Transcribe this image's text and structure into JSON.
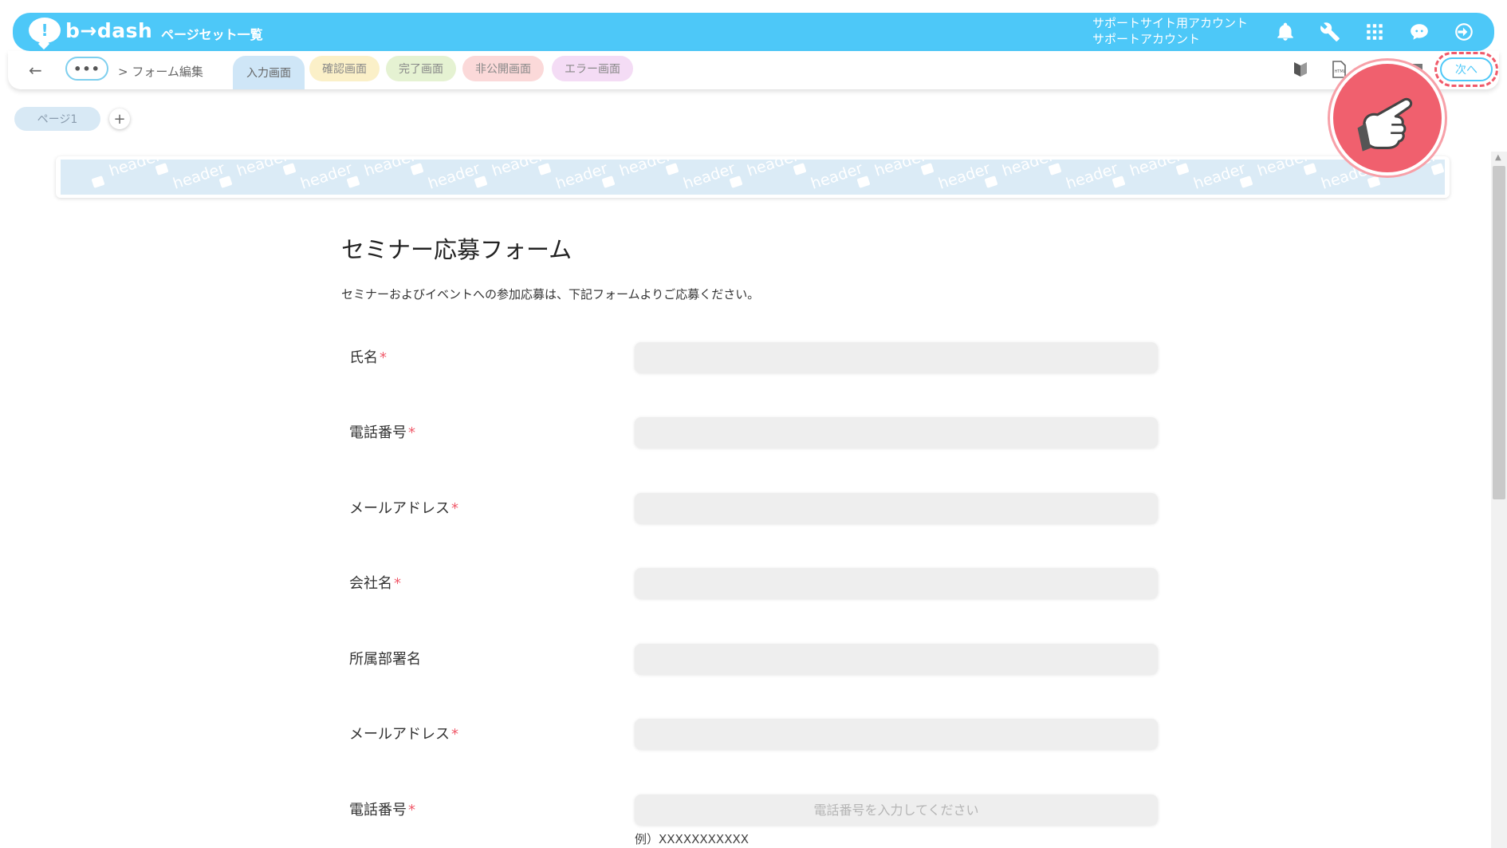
{
  "app": {
    "logo_text": "b→dash",
    "page_title": "ページセット一覧",
    "account_line1": "サポートサイト用アカウント",
    "account_line2": "サポートアカウント"
  },
  "nav": {
    "dots": "•••",
    "breadcrumb": "> フォーム編集",
    "tabs": [
      {
        "label": "入力画面",
        "bg": "#cfe6f7"
      },
      {
        "label": "確認画面",
        "bg": "#fbf0c8"
      },
      {
        "label": "完了画面",
        "bg": "#e5f2d2"
      },
      {
        "label": "非公開画面",
        "bg": "#fbd9d9"
      },
      {
        "label": "エラー画面",
        "bg": "#f4dcf5"
      }
    ],
    "next_label": "次へ"
  },
  "pages": {
    "tab_label": "ページ1",
    "add_label": "+"
  },
  "banner": {
    "word": "header"
  },
  "form": {
    "title": "セミナー応募フォーム",
    "description": "セミナーおよびイベントへの参加応募は、下記フォームよりご応募ください。",
    "required_mark": "*",
    "fields": [
      {
        "label": "氏名",
        "required": true,
        "placeholder": ""
      },
      {
        "label": "電話番号",
        "required": true,
        "placeholder": ""
      },
      {
        "label": "メールアドレス",
        "required": true,
        "placeholder": ""
      },
      {
        "label": "会社名",
        "required": true,
        "placeholder": ""
      },
      {
        "label": "所属部署名",
        "required": false,
        "placeholder": ""
      },
      {
        "label": "メールアドレス",
        "required": true,
        "placeholder": ""
      },
      {
        "label": "電話番号",
        "required": true,
        "placeholder": "電話番号を入力してください"
      }
    ],
    "phone_hint": "例）XXXXXXXXXXX"
  },
  "colors": {
    "brand": "#4dc8f8",
    "required": "#f05a6a",
    "pointer": "#f0606e"
  },
  "icons": [
    "bell-icon",
    "wrench-icon",
    "apps-grid-icon",
    "chat-bot-icon",
    "logout-icon",
    "beginner-mark-icon",
    "html-file-icon",
    "pointing-hand-icon"
  ]
}
